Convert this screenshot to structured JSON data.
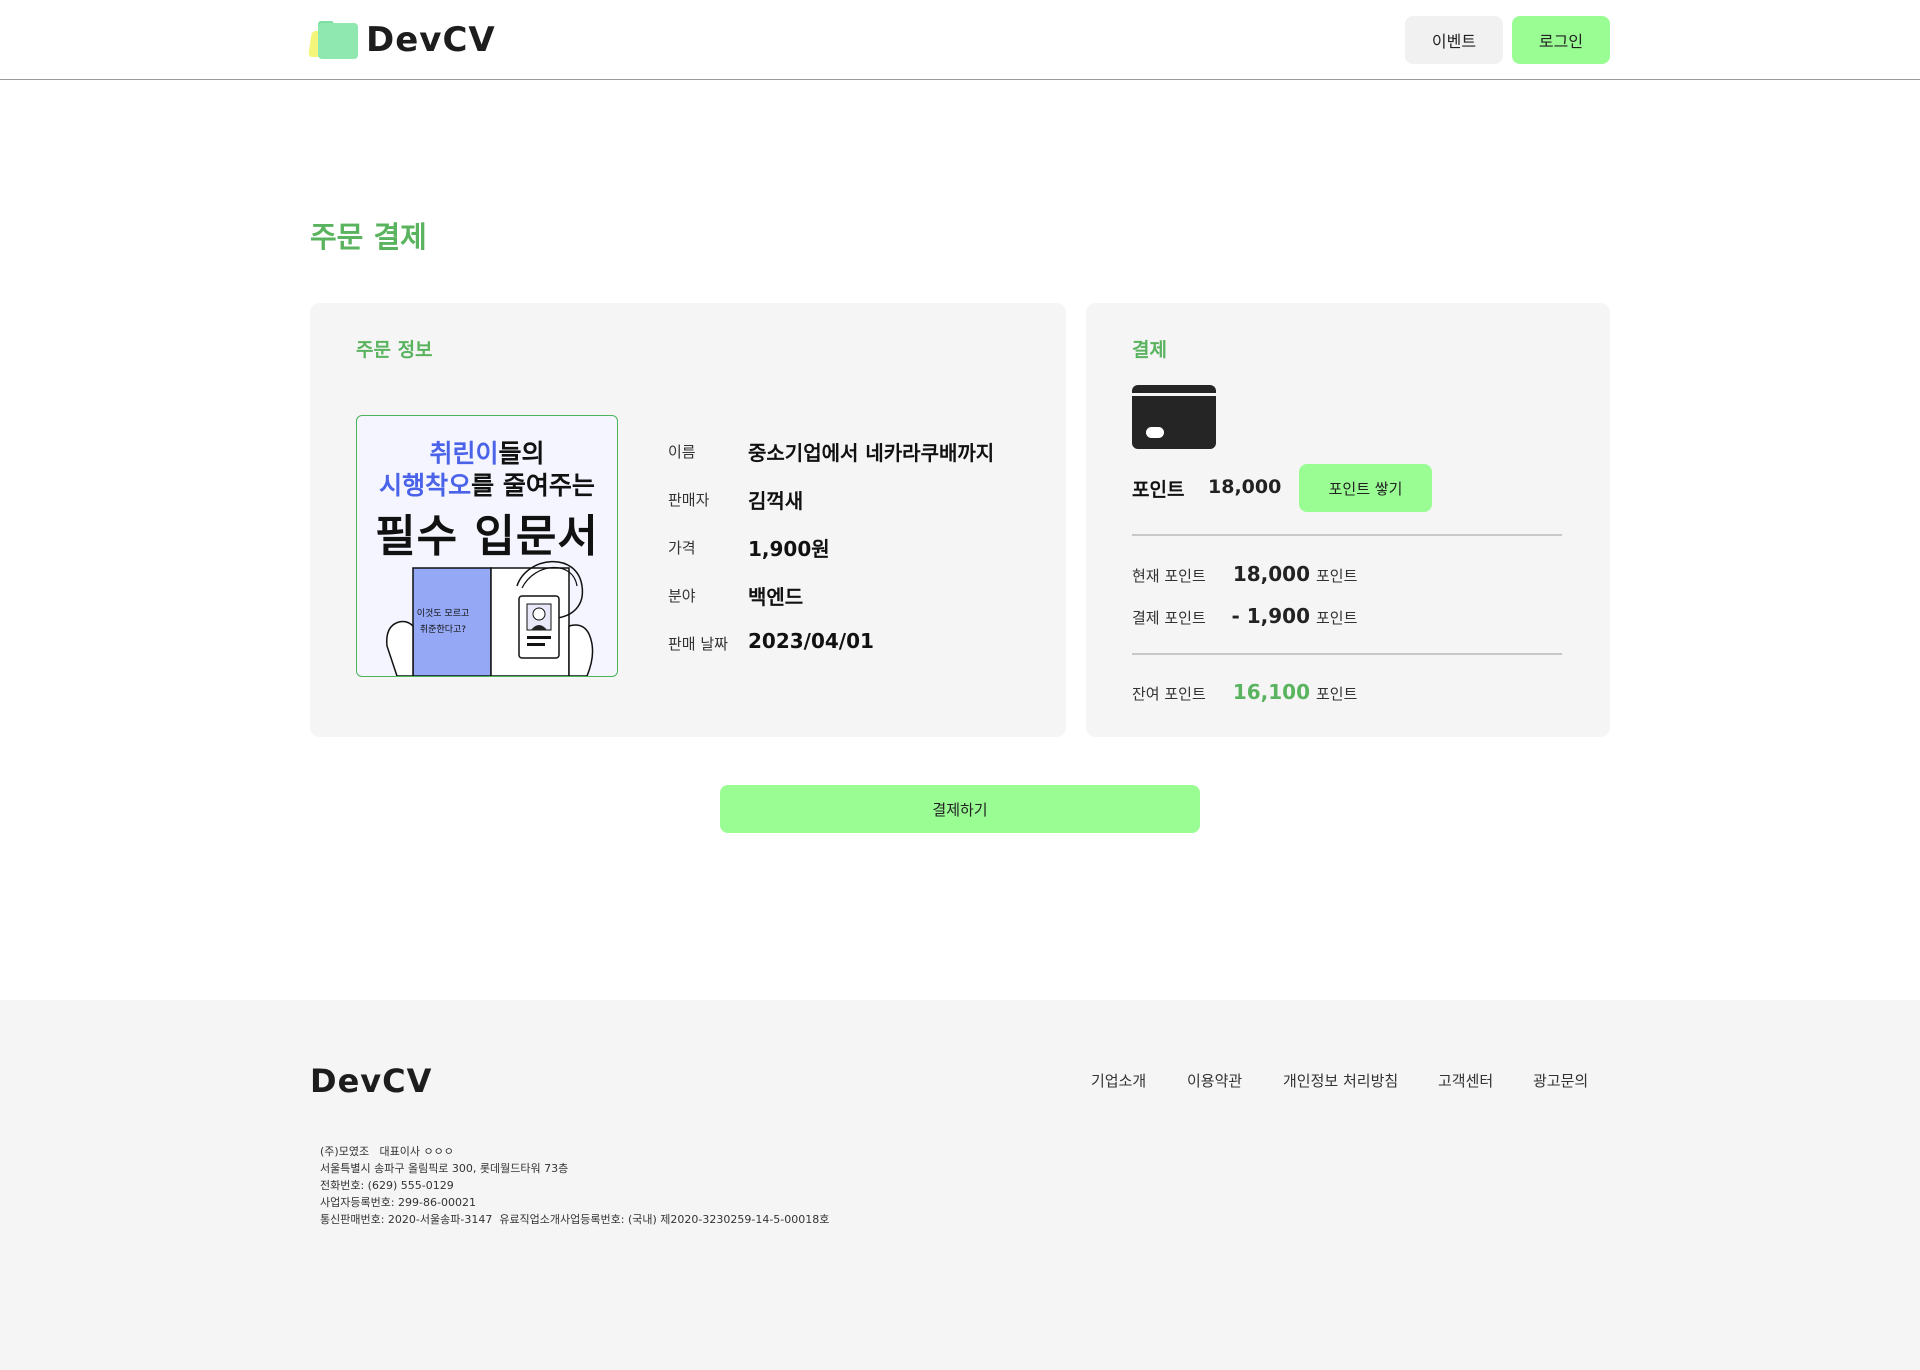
{
  "header": {
    "logo_text": "DevCV",
    "event_label": "이벤트",
    "login_label": "로그인"
  },
  "page": {
    "title": "주문 결제"
  },
  "order_info": {
    "title": "주문 정보",
    "cover": {
      "line1_a": "취린이",
      "line1_b": "들의",
      "line2_a": "시행착오",
      "line2_b": "를 줄여주는",
      "line3": "필수 입문서",
      "small_1": "이것도 모르고",
      "small_2": "취준한다고?"
    },
    "rows": [
      {
        "label": "이름",
        "value": "중소기업에서 네카라쿠배까지"
      },
      {
        "label": "판매자",
        "value": "김꺽새"
      },
      {
        "label": "가격",
        "value": "1,900원"
      },
      {
        "label": "분야",
        "value": "백엔드"
      },
      {
        "label": "판매 날짜",
        "value": "2023/04/01"
      }
    ]
  },
  "payment": {
    "title": "결제",
    "icon": "credit-card-icon",
    "point_label": "포인트",
    "point_value": "18,000",
    "charge_label": "포인트 쌓기",
    "current_label": "현재 포인트",
    "current_value": "18,000",
    "current_unit": "포인트",
    "pay_label": "결제 포인트",
    "pay_value": "- 1,900",
    "pay_unit": "포인트",
    "remain_label": "잔여 포인트",
    "remain_value": "16,100",
    "remain_unit": "포인트"
  },
  "pay_button_label": "결제하기",
  "footer": {
    "logo_text": "DevCV",
    "links": [
      "기업소개",
      "이용약관",
      "개인정보 처리방침",
      "고객센터",
      "광고문의"
    ],
    "company_lines": [
      "(주)모였조   대표이사 ㅇㅇㅇ",
      "서울특별시 송파구 올림픽로 300, 롯데월드타워 73층",
      "전화번호: (629) 555-0129",
      "사업자등록번호: 299-86-00021",
      "통신판매번호: 2020-서울송파-3147  유료직업소개사업등록번호: (국내) 제2020-3230259-14-5-00018호"
    ]
  },
  "colors": {
    "accent_green": "#99fd94",
    "title_green": "#5ab35e",
    "card_bg": "#f5f5f5",
    "cover_blue": "#4a63e8"
  }
}
